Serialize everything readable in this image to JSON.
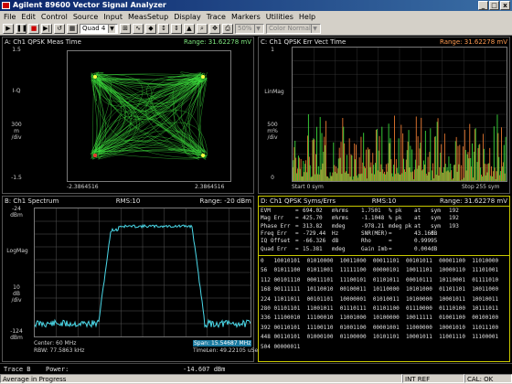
{
  "window": {
    "title": "Agilent 89600 Vector Signal Analyzer",
    "controls": [
      "_",
      "□",
      "x"
    ]
  },
  "menu": [
    "File",
    "Edit",
    "Control",
    "Source",
    "Input",
    "MeasSetup",
    "Display",
    "Trace",
    "Markers",
    "Utilities",
    "Help"
  ],
  "toolbar": {
    "layout": "Quad 4",
    "zoom": "50%",
    "color_scheme": "Color Normal"
  },
  "traceA": {
    "header": "A: Ch1 QPSK Meas Time",
    "range": "Range: 31.62278 mV",
    "y_top": "1.5",
    "y_mid_top": "I-Q",
    "y_mid": "300",
    "y_mid_unit": "m",
    "y_mid_div": "/div",
    "y_bottom": "-1.5",
    "x_left": "-2.3864516",
    "x_right": "2.3864516"
  },
  "traceC": {
    "header": "C: Ch1 QPSK Err Vect Time",
    "range": "Range: 31.62278 mV",
    "y_top": "1",
    "y_scale": "LinMag",
    "y_mid": "500",
    "y_mid_unit": "m%",
    "y_mid_div": "/div",
    "y_bottom": "0",
    "x_left": "Start 0 sym",
    "x_right": "Stop 255 sym"
  },
  "traceB": {
    "header": "B: Ch1 Spectrum",
    "mid": "RMS:10",
    "range": "Range: -20 dBm",
    "y_top": "-24",
    "y_top_unit": "dBm",
    "y_scale": "LogMag",
    "y_mid": "10",
    "y_mid_unit": "dB",
    "y_mid_div": "/div",
    "y_bottom": "-124",
    "y_bottom_unit": "dBm",
    "center": "Center: 60 MHz",
    "rbw": "RBW: 77.5863 kHz",
    "span": "Span: 15.54687 MHz",
    "timelen": "TimeLen: 49.22105 uSec"
  },
  "traceD": {
    "header": "D: Ch1 QPSK Syms/Errs",
    "mid": "RMS:10",
    "range": "Range: 31.62278 mV",
    "metrics": [
      [
        "EVM",
        "=",
        "694.02",
        "m%rms",
        "1.7501",
        "% pk",
        "at",
        "sym",
        "192"
      ],
      [
        "Mag Err",
        "=",
        "425.70",
        "m%rms",
        "-1.1048",
        "% pk",
        "at",
        "sym",
        "192"
      ],
      [
        "Phase Err",
        "=",
        "313.82",
        "mdeg",
        "-978.21",
        "mdeg pk",
        "at",
        "sym",
        "193"
      ],
      [
        "Freq Err",
        "=",
        "-729.44",
        "Hz",
        "SNR(MER)",
        "=",
        "43.168",
        "dB",
        ""
      ],
      [
        "IQ Offset",
        "=",
        "-66.326",
        "dB",
        "Rho",
        "=",
        "0.99995",
        "",
        ""
      ],
      [
        "Quad Err",
        "=",
        "15.381",
        "mdeg",
        "Gain Imb",
        "=",
        "0.004",
        "dB",
        ""
      ]
    ],
    "symbols": [
      "0   10010101  01010000  10011000  00011101  00101011  00001100  11010000",
      "56  01011100  01011001  11111100  00000101  10011101  10000110  11101001",
      "112 00101110  00011101  11100101  01101011  00010111  10110001  01111010",
      "168 00111111  10110010  00100011  10110000  10101000  01101101  10011000",
      "224 11011011  00101101  10000001  01010011  10100000  10001011  10010011",
      "280 01101101  11001011  01110111  01101100  01110000  01110100  10111011",
      "336 11100010  11100010  11001000  10100000  10011111  01001100  00100100",
      "392 00110101  11100110  01001100  00001001  11000000  10001010  11011100",
      "448 00110101  01000100  01100000  10101101  10001011  11001110  11100001",
      "504 00000011"
    ]
  },
  "statusline": {
    "trace": "Trace B",
    "label": "Power:",
    "value": "-14.607 dBm"
  },
  "statusbar": {
    "message": "Average in Progress",
    "ref": "INT REF",
    "cal": "CAL: OK"
  },
  "colors": {
    "green": "#3cdc3c",
    "cyan": "#4ad8e8",
    "orange": "#e87830",
    "yellow": "#ffff40",
    "red": "#e83030"
  }
}
